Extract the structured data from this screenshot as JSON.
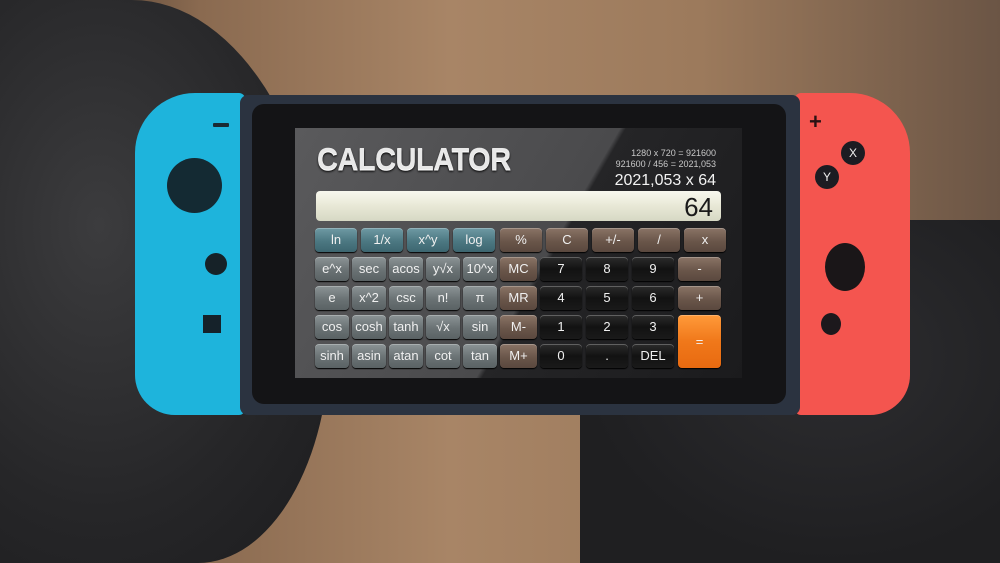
{
  "device": {
    "left_joycon": {
      "color": "#1eb4dc",
      "buttons": [
        "minus-button"
      ]
    },
    "right_joycon": {
      "color": "#f4554f",
      "plus_label": "+",
      "x_label": "X",
      "y_label": "Y"
    }
  },
  "app": {
    "title": "CALCULATOR",
    "history": [
      "1280 x 720 = 921600",
      "921600 / 456 = 2021,053"
    ],
    "expression": "2021,053 x 64",
    "display_value": "64"
  },
  "keypad": {
    "rows": [
      [
        {
          "label": "ln",
          "style": "teal"
        },
        {
          "label": "1/x",
          "style": "teal"
        },
        {
          "label": "x^y",
          "style": "teal"
        },
        {
          "label": "log",
          "style": "teal"
        },
        {
          "label": "%",
          "style": "brown"
        },
        {
          "label": "C",
          "style": "brown"
        },
        {
          "label": "+/-",
          "style": "brown"
        },
        {
          "label": "/",
          "style": "brown"
        },
        {
          "label": "x",
          "style": "brown"
        }
      ],
      [
        {
          "label": "e^x",
          "style": "gray"
        },
        {
          "label": "sec",
          "style": "gray"
        },
        {
          "label": "acos",
          "style": "gray"
        },
        {
          "label": "y√x",
          "style": "gray"
        },
        {
          "label": "10^x",
          "style": "gray"
        },
        {
          "label": "MC",
          "style": "brown"
        },
        {
          "label": "7",
          "style": "black"
        },
        {
          "label": "8",
          "style": "black"
        },
        {
          "label": "9",
          "style": "black"
        },
        {
          "label": "-",
          "style": "brown"
        }
      ],
      [
        {
          "label": "e",
          "style": "gray"
        },
        {
          "label": "x^2",
          "style": "gray"
        },
        {
          "label": "csc",
          "style": "gray"
        },
        {
          "label": "n!",
          "style": "gray"
        },
        {
          "label": "π",
          "style": "gray"
        },
        {
          "label": "MR",
          "style": "brown"
        },
        {
          "label": "4",
          "style": "black"
        },
        {
          "label": "5",
          "style": "black"
        },
        {
          "label": "6",
          "style": "black"
        },
        {
          "label": "+",
          "style": "brown"
        }
      ],
      [
        {
          "label": "cos",
          "style": "gray"
        },
        {
          "label": "cosh",
          "style": "gray"
        },
        {
          "label": "tanh",
          "style": "gray"
        },
        {
          "label": "√x",
          "style": "gray"
        },
        {
          "label": "sin",
          "style": "gray"
        },
        {
          "label": "M-",
          "style": "brown"
        },
        {
          "label": "1",
          "style": "black"
        },
        {
          "label": "2",
          "style": "black"
        },
        {
          "label": "3",
          "style": "black"
        }
      ],
      [
        {
          "label": "sinh",
          "style": "gray"
        },
        {
          "label": "asin",
          "style": "gray"
        },
        {
          "label": "atan",
          "style": "gray"
        },
        {
          "label": "cot",
          "style": "gray"
        },
        {
          "label": "tan",
          "style": "gray"
        },
        {
          "label": "M+",
          "style": "brown"
        },
        {
          "label": "0",
          "style": "black"
        },
        {
          "label": ".",
          "style": "black"
        },
        {
          "label": "DEL",
          "style": "black"
        }
      ]
    ],
    "equals": {
      "label": "=",
      "style": "orange"
    }
  }
}
